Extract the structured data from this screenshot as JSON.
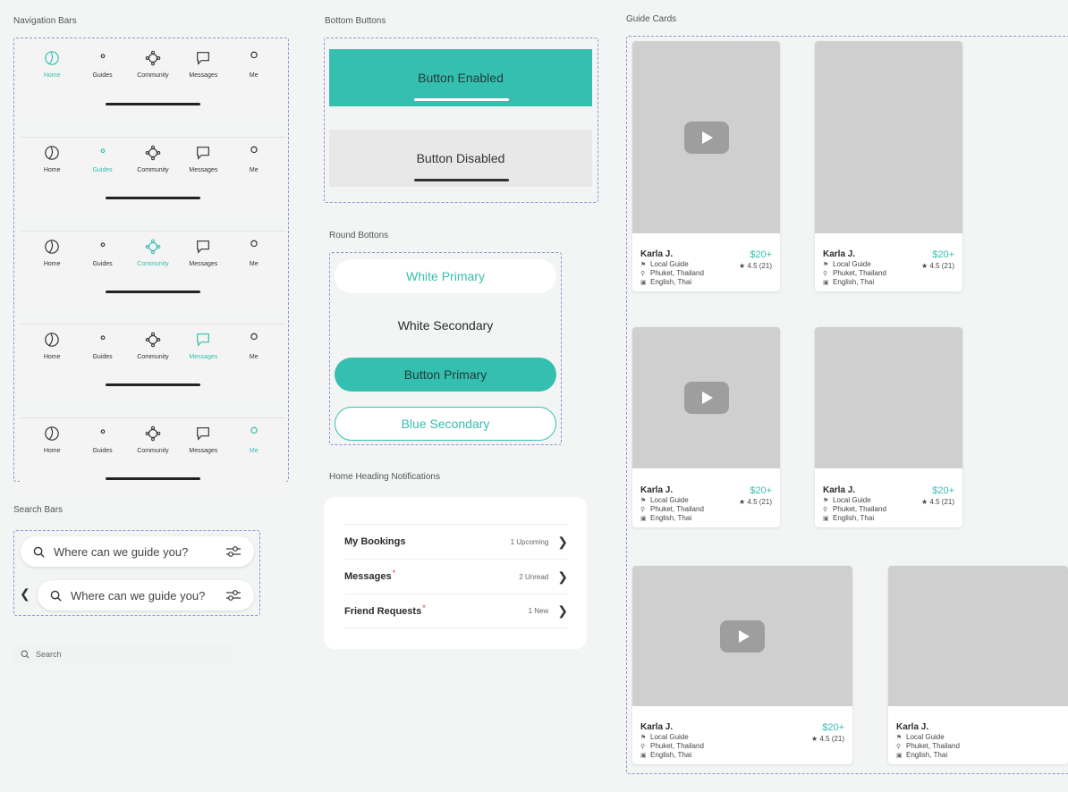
{
  "sections": {
    "navigation_bars": "Navigation Bars",
    "bottom_buttons": "Bottom Buttons",
    "round_buttons": "Round Bottons",
    "home_heading": "Home Heading Notifications",
    "search_bars": "Search Bars",
    "guide_cards": "Guide Cards"
  },
  "nav": {
    "labels": [
      "Home",
      "Guides",
      "Community",
      "Messages",
      "Me"
    ]
  },
  "bottom_buttons": {
    "enabled": "Button Enabled",
    "disabled": "Button Disabled"
  },
  "round_buttons": {
    "white_primary": "White Primary",
    "white_secondary": "White Secondary",
    "button_primary": "Button Primary",
    "blue_secondary": "Blue Secondary"
  },
  "notifications": [
    {
      "title": "My Bookings",
      "meta": "1 Upcoming",
      "star": ""
    },
    {
      "title": "Messages",
      "meta": "2 Unread",
      "star": "*"
    },
    {
      "title": "Friend Requests",
      "meta": "1 New",
      "star": "*"
    }
  ],
  "search": {
    "placeholder": "Where can we guide you?",
    "small_placeholder": "Search"
  },
  "card": {
    "name": "Karla J.",
    "price": "$20+",
    "rating": "★ 4.5 (21)",
    "role": "Local Guide",
    "location": "Phuket, Thailand",
    "languages": "English, Thai"
  },
  "colors": {
    "accent": "#35bfb0",
    "background": "#f2f5f4",
    "disabled": "#e8e8e8",
    "image_placeholder": "#cfcfcf"
  }
}
